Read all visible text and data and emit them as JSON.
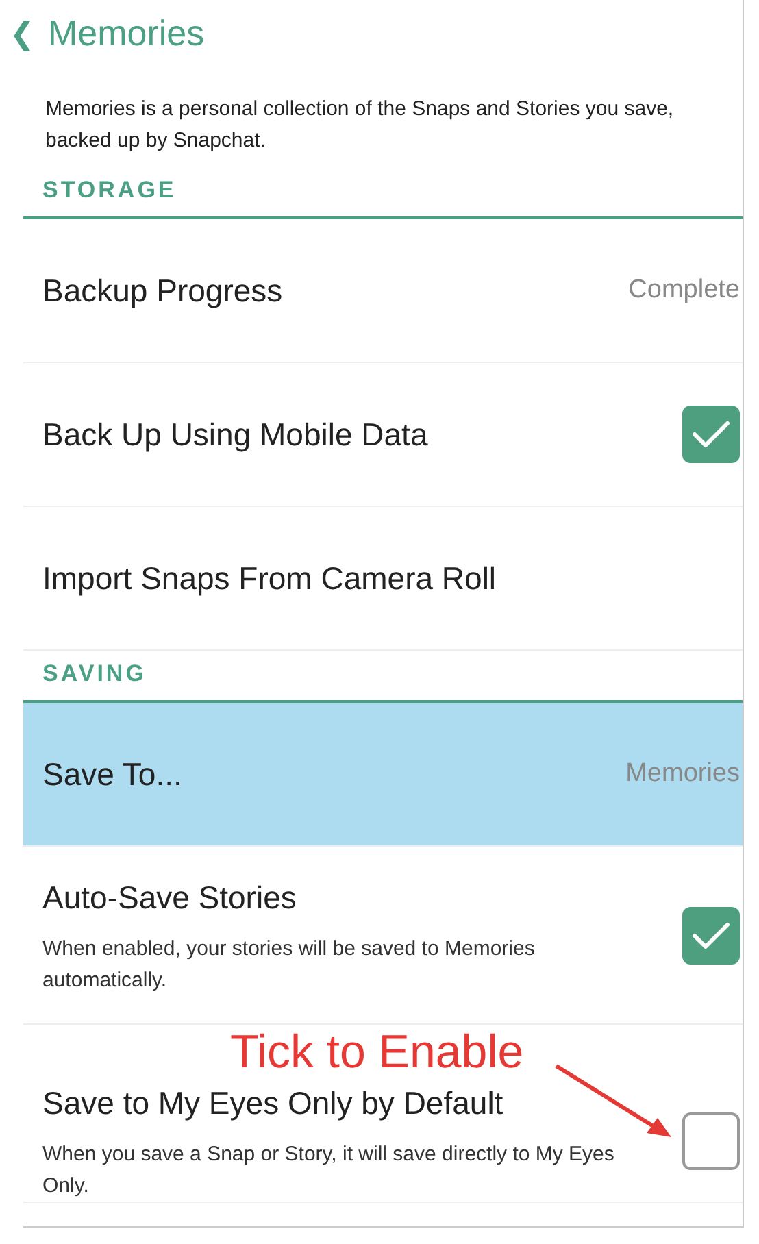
{
  "header": {
    "back_icon": "❮",
    "title": "Memories"
  },
  "description": "Memories is a personal collection of the Snaps and Stories you save, backed up by Snapchat.",
  "sections": [
    {
      "title": "STORAGE",
      "rows": [
        {
          "kind": "value",
          "label": "Backup Progress",
          "value": "Complete"
        },
        {
          "kind": "checkbox",
          "label": "Back Up Using Mobile Data",
          "checked": true
        },
        {
          "kind": "plain",
          "label": "Import Snaps From Camera Roll"
        }
      ]
    },
    {
      "title": "SAVING",
      "rows": [
        {
          "kind": "value",
          "label": "Save To...",
          "value": "Memories",
          "selected": true
        },
        {
          "kind": "checkbox",
          "label": "Auto-Save Stories",
          "subtitle": "When enabled, your stories will be saved to Memories automatically.",
          "checked": true
        },
        {
          "kind": "checkbox",
          "label": "Save to My Eyes Only by Default",
          "subtitle": "When you save a Snap or Story, it will save directly to My Eyes Only.",
          "checked": false
        }
      ]
    }
  ],
  "annotation": {
    "text": "Tick to Enable"
  }
}
